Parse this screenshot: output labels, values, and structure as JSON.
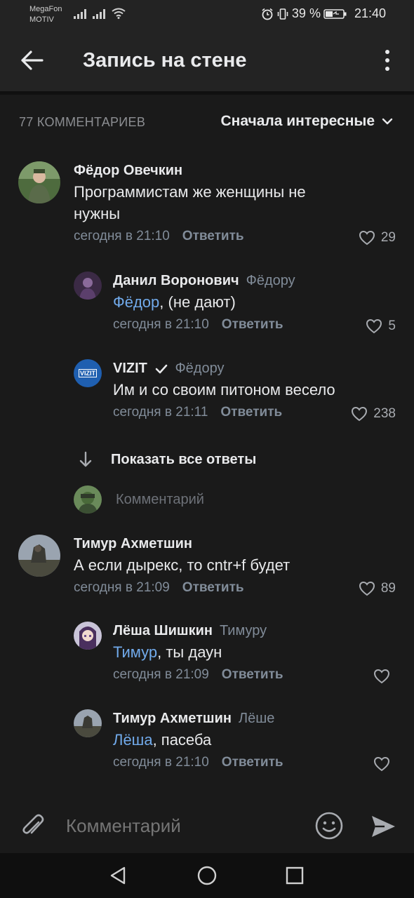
{
  "status_bar": {
    "carrier_line1": "MegaFon",
    "carrier_line2": "MOTIV",
    "battery": "39 %",
    "time": "21:40",
    "icons": [
      "signal-icon",
      "signal-icon",
      "wifi-icon",
      "alarm-icon",
      "vibrate-icon",
      "battery-icon"
    ]
  },
  "app_bar": {
    "title": "Запись на стене",
    "back_icon": "arrow-left-icon",
    "menu_icon": "more-vertical-icon"
  },
  "comments_header": {
    "count_label": "77 КОММЕНТАРИЕВ",
    "sort_label": "Сначала интересные"
  },
  "comments": [
    {
      "author": "Фёдор Овечкин",
      "text": "Программистам же женщины не нужны",
      "time": "сегодня в 21:10",
      "reply_label": "Ответить",
      "likes": "29"
    },
    {
      "author": "Данил Воронович",
      "reply_to": "Фёдору",
      "mention": "Фёдор",
      "text": ", (не дают)",
      "time": "сегодня в 21:10",
      "reply_label": "Ответить",
      "likes": "5"
    },
    {
      "author": "VIZIT",
      "reply_to": "Фёдору",
      "avatar_text": "VIZIT",
      "text": "Им и со своим питоном весело",
      "time": "сегодня в 21:11",
      "reply_label": "Ответить",
      "likes": "238"
    },
    {
      "author": "Тимур Ахметшин",
      "text": "А если дырекс, то cntr+f будет",
      "time": "сегодня в 21:09",
      "reply_label": "Ответить",
      "likes": "89"
    },
    {
      "author": "Лёша Шишкин",
      "reply_to": "Тимуру",
      "mention": "Тимур",
      "text": ", ты даун",
      "time": "сегодня в 21:09",
      "reply_label": "Ответить",
      "likes": ""
    },
    {
      "author": "Тимур Ахметшин",
      "reply_to": "Лёше",
      "mention": "Лёша",
      "text": ", пасеба",
      "time": "сегодня в 21:10",
      "reply_label": "Ответить",
      "likes": ""
    }
  ],
  "show_replies_label": "Показать все ответы",
  "mini_reply_placeholder": "Комментарий",
  "composer": {
    "placeholder": "Комментарий"
  },
  "colors": {
    "background": "#1a1a1a",
    "bar": "#232323",
    "accent_link": "#71aaeb",
    "secondary_text": "#818c99"
  }
}
